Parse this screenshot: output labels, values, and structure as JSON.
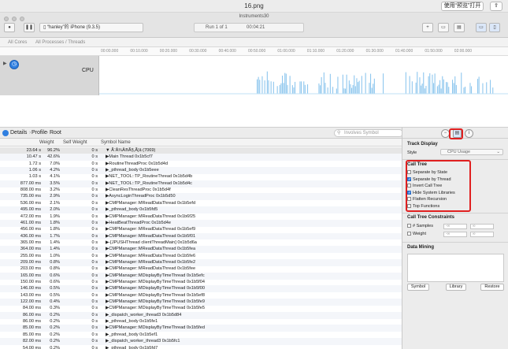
{
  "window": {
    "title": "16.png",
    "open_preview_label": "使用“预览”打开",
    "share_label": "⇪"
  },
  "toolbar": {
    "app_title": "Instruments30",
    "device": "“hanley”的 iPhone (9.3.5)",
    "process": "",
    "run": "Run 1 of 1",
    "time": "00:04:21"
  },
  "scope_bar": {
    "left": "All Cores",
    "right": "All Processes / Threads"
  },
  "ruler_ticks": [
    "00:00.000",
    "00:10.000",
    "00:20.000",
    "00:30.000",
    "00:40.000",
    "00:50.000",
    "01:00.000",
    "01:10.000",
    "01:20.000",
    "01:30.000",
    "01:40.000",
    "01:50.000",
    "02:00.000"
  ],
  "track": {
    "label": "CPU"
  },
  "detail_bar": {
    "details": "Details",
    "profile": "Profile",
    "root": "Root",
    "filter_placeholder": "Involves Symbol"
  },
  "table": {
    "headers": {
      "weight": "Weight",
      "self_weight": "Self Weight",
      "symbol": "Symbol Name"
    },
    "rows": [
      {
        "w": "23.64 s",
        "p": "96.2%",
        "s": "0 s",
        "n": "▼ Ã¨Â¾Â®Ã§,Ã¦â (7069)"
      },
      {
        "w": "10.47 s",
        "p": "42.6%",
        "s": "0 s",
        "n": "▶Main Thread  0x1b5cf7"
      },
      {
        "w": "1.72 s",
        "p": "7.0%",
        "s": "0 s",
        "n": "▶RoutineThreadProc  0x1b5d4d"
      },
      {
        "w": "1.06 s",
        "p": "4.2%",
        "s": "0 s",
        "n": "▶_pthread_body  0x1b5eee"
      },
      {
        "w": "1.03 s",
        "p": "4.1%",
        "s": "0 s",
        "n": "▶NET_TOOL::TP_RoutineThread  0x1b5d4b"
      },
      {
        "w": "877.00 ms",
        "p": "3.5%",
        "s": "0 s",
        "n": "▶NET_TOOL::TP_RoutineThread  0x1b5d4c"
      },
      {
        "w": "808.00 ms",
        "p": "3.2%",
        "s": "0 s",
        "n": "▶CleanResThreadProc  0x1b5d4f"
      },
      {
        "w": "735.00 ms",
        "p": "2.9%",
        "s": "0 s",
        "n": "▶AsyncLoginThreadProc  0x1b5d50"
      },
      {
        "w": "536.00 ms",
        "p": "2.1%",
        "s": "0 s",
        "n": "▶CMPManager::MReadDataThread  0x1b5efd"
      },
      {
        "w": "495.00 ms",
        "p": "2.0%",
        "s": "0 s",
        "n": "▶_pthread_body  0x1b5fd5"
      },
      {
        "w": "472.00 ms",
        "p": "1.9%",
        "s": "0 s",
        "n": "▶CMPManager::MReadDataThread  0x1b6f25"
      },
      {
        "w": "461.00 ms",
        "p": "1.8%",
        "s": "0 s",
        "n": "▶HeatBeatThreadProc  0x1b5d4e"
      },
      {
        "w": "456.00 ms",
        "p": "1.8%",
        "s": "0 s",
        "n": "▶CMPManager::MReadDataThread  0x1b5ef9"
      },
      {
        "w": "436.00 ms",
        "p": "1.7%",
        "s": "0 s",
        "n": "▶CMPManager::MReadDataThread  0x1b5f01"
      },
      {
        "w": "365.00 ms",
        "p": "1.4%",
        "s": "0 s",
        "n": "▶-[JPUSHThread clientThreadMain]  0x1b5d6a"
      },
      {
        "w": "364.00 ms",
        "p": "1.4%",
        "s": "0 s",
        "n": "▶CMPManager::MReadDataThread  0x1b5fea"
      },
      {
        "w": "255.00 ms",
        "p": "1.0%",
        "s": "0 s",
        "n": "▶CMPManager::MReadDataThread  0x1b5fe6"
      },
      {
        "w": "209.00 ms",
        "p": "0.8%",
        "s": "0 s",
        "n": "▶CMPManager::MReadDataThread  0x1b5fe2"
      },
      {
        "w": "203.00 ms",
        "p": "0.8%",
        "s": "0 s",
        "n": "▶CMPManager::MReadDataThread  0x1b5fee"
      },
      {
        "w": "165.00 ms",
        "p": "0.6%",
        "s": "0 s",
        "n": "▶CMPManager::MDisplayByTimeThread  0x1b5efc"
      },
      {
        "w": "150.00 ms",
        "p": "0.6%",
        "s": "0 s",
        "n": "▶CMPManager::MDisplayByTimeThread  0x1b5f04"
      },
      {
        "w": "146.00 ms",
        "p": "0.5%",
        "s": "0 s",
        "n": "▶CMPManager::MDisplayByTimeThread  0x1b5f00"
      },
      {
        "w": "143.00 ms",
        "p": "0.5%",
        "s": "0 s",
        "n": "▶CMPManager::MDisplayByTimeThread  0x1b5ef8"
      },
      {
        "w": "122.00 ms",
        "p": "0.4%",
        "s": "0 s",
        "n": "▶CMPManager::MDisplayByTimeThread  0x1b5fe9"
      },
      {
        "w": "84.00 ms",
        "p": "0.3%",
        "s": "0 s",
        "n": "▶CMPManager::MDisplayByTimeThread  0x1b5fe5"
      },
      {
        "w": "86.00 ms",
        "p": "0.2%",
        "s": "0 s",
        "n": "▶_dispatch_worker_thread3  0x1b5d84"
      },
      {
        "w": "86.00 ms",
        "p": "0.2%",
        "s": "0 s",
        "n": "▶_pthread_body  0x1b5fe1"
      },
      {
        "w": "85.00 ms",
        "p": "0.2%",
        "s": "0 s",
        "n": "▶CMPManager::MDisplayByTimeThread  0x1b5fed"
      },
      {
        "w": "85.00 ms",
        "p": "0.2%",
        "s": "0 s",
        "n": "▶_pthread_body  0x1b5ef1"
      },
      {
        "w": "82.00 ms",
        "p": "0.2%",
        "s": "0 s",
        "n": "▶_dispatch_worker_thread3  0x1b5fc1"
      },
      {
        "w": "54.00 ms",
        "p": "0.2%",
        "s": "0 s",
        "n": "▶_pthread_body  0x1b5fd7"
      },
      {
        "w": "50.00 ms",
        "p": "0.2%",
        "s": "0 s",
        "n": "▶_dispatch_worker_thread3  0x1b5d57"
      }
    ]
  },
  "inspector": {
    "track_display": "Track Display",
    "style_label": "Style",
    "style_value": "CPU Usage",
    "call_tree": "Call Tree",
    "options": [
      {
        "label": "Separate by State",
        "checked": false
      },
      {
        "label": "Separate by Thread",
        "checked": true
      },
      {
        "label": "Invert Call Tree",
        "checked": false
      },
      {
        "label": "Hide System Libraries",
        "checked": true
      },
      {
        "label": "Flatten Recursion",
        "checked": false
      },
      {
        "label": "Top Functions",
        "checked": false
      }
    ],
    "constraints": "Call Tree Constraints",
    "samples_label": "# Samples",
    "weight_label": "Weight",
    "min_ph": "-∞",
    "max_ph": "∞",
    "data_mining": "Data Mining",
    "symbol_btn": "Symbol",
    "library_btn": "Library",
    "restore_btn": "Restore"
  },
  "cpu_activity": [
    0,
    0,
    0,
    0,
    0,
    0,
    0,
    0,
    0,
    0,
    0,
    0,
    0,
    0,
    0,
    0,
    0,
    0,
    0,
    0,
    0,
    0,
    0,
    0,
    0,
    0,
    0,
    0,
    0,
    0,
    0,
    0,
    0,
    0,
    0,
    0,
    0,
    0,
    0,
    0,
    0,
    0,
    0,
    0,
    0,
    0,
    0,
    0,
    0,
    0,
    2,
    0,
    0,
    3,
    0,
    0,
    0,
    0,
    0,
    0,
    0,
    0,
    0,
    0,
    0,
    0,
    0,
    0,
    0,
    0,
    0,
    0,
    0,
    0,
    0,
    0,
    0,
    0,
    0,
    0,
    0,
    0,
    0,
    0,
    0,
    0,
    0,
    0,
    0,
    0,
    0,
    0,
    0,
    0,
    0,
    0,
    0,
    0,
    0,
    0,
    0,
    0,
    0,
    0,
    0,
    0,
    0,
    0,
    0,
    0,
    0,
    0,
    0,
    0,
    0,
    0,
    0,
    0,
    0,
    0,
    0,
    0,
    0,
    0,
    0,
    0,
    0,
    0,
    0,
    0,
    0,
    0,
    0,
    0,
    0,
    0,
    0,
    0,
    0,
    0,
    0,
    0,
    0,
    0,
    0,
    0,
    0,
    0,
    0,
    0,
    0,
    0,
    0,
    0,
    0,
    0,
    0,
    0,
    0,
    0,
    0,
    0,
    0,
    0,
    0,
    0,
    0,
    0,
    0,
    0,
    0,
    0,
    0,
    0,
    0,
    0,
    0,
    0,
    0,
    0,
    0,
    0,
    0,
    0,
    0,
    0,
    0,
    0,
    0,
    0,
    0,
    0,
    0,
    0,
    0,
    0,
    0,
    0,
    0,
    0,
    0,
    0,
    0,
    0,
    0,
    0,
    0,
    0,
    0,
    0,
    0,
    0,
    0,
    0,
    0,
    0,
    0,
    0,
    0,
    0,
    0,
    0,
    0,
    0,
    0,
    0,
    0,
    0,
    0,
    0,
    0,
    0,
    0,
    0,
    0,
    0,
    0,
    0,
    0,
    0,
    0,
    0,
    0,
    0,
    0,
    0,
    0,
    0,
    0,
    0,
    0,
    0,
    0,
    0,
    0,
    0,
    0,
    0,
    0,
    0,
    0,
    0,
    0,
    0,
    0,
    0,
    0,
    0,
    0,
    0,
    0,
    0,
    0,
    0,
    0,
    0,
    0,
    0,
    0,
    0,
    0,
    0,
    0,
    0,
    0,
    0,
    0,
    0,
    0,
    0,
    0,
    0,
    0,
    0,
    0,
    0,
    0,
    0,
    0,
    0,
    0,
    0,
    0,
    0,
    0,
    0,
    0,
    0,
    0,
    0,
    0,
    0,
    0,
    0,
    0,
    0,
    0,
    0,
    0,
    0,
    0,
    0,
    0,
    0,
    0,
    0,
    0,
    0,
    0,
    0,
    0,
    0,
    0,
    0,
    0,
    0,
    0,
    0,
    0,
    0,
    0,
    0,
    0,
    0,
    0,
    0,
    0,
    0,
    0,
    0,
    0,
    0,
    0,
    0,
    0,
    0,
    0,
    0,
    0,
    0,
    0,
    0,
    0,
    0,
    0,
    0,
    0,
    0,
    0,
    0,
    0,
    0,
    0,
    0,
    0,
    0,
    0,
    0,
    0,
    0,
    0,
    0,
    0,
    0,
    0,
    0,
    0,
    0,
    0,
    0,
    0,
    0,
    0,
    0,
    0,
    0,
    0,
    0,
    0,
    0,
    0,
    0,
    0,
    0,
    0,
    0,
    0,
    0,
    0,
    0,
    0,
    0,
    0,
    0,
    0,
    0,
    0,
    0,
    0,
    0,
    0,
    0,
    0,
    0,
    0,
    0,
    0,
    0,
    0,
    0,
    0,
    0,
    0,
    0,
    0,
    0,
    0,
    0,
    0,
    0,
    0,
    0,
    0,
    0,
    0,
    0,
    0,
    0,
    0,
    0,
    0,
    0,
    0,
    0,
    0,
    0,
    0,
    0,
    0,
    0,
    0,
    0,
    0,
    0,
    0,
    0,
    0,
    0,
    0,
    0,
    0,
    0,
    0,
    0,
    0,
    0,
    0,
    0,
    0,
    0,
    0,
    0,
    0,
    0,
    0,
    0,
    0,
    0,
    0,
    0,
    0,
    0,
    0,
    0,
    0,
    0,
    0,
    0,
    0,
    0,
    0,
    0,
    0,
    0,
    0,
    0,
    0,
    0,
    0,
    0,
    0,
    0,
    0,
    0,
    0,
    0,
    0,
    0,
    0,
    0,
    0,
    0,
    0,
    0,
    0,
    0,
    0,
    0,
    0,
    0,
    0,
    0,
    0,
    0,
    0,
    0,
    0,
    0,
    0,
    0,
    0,
    0,
    0,
    0,
    0,
    0,
    0,
    0,
    0,
    0,
    0,
    0,
    0,
    0,
    0,
    0,
    0,
    0,
    0,
    0,
    0,
    0,
    0,
    0,
    0,
    0,
    0,
    0,
    0,
    0,
    0,
    0,
    0,
    0,
    0,
    0,
    0,
    0,
    0,
    0,
    0,
    0,
    0,
    0,
    0,
    0,
    0,
    0,
    0,
    0,
    0,
    0,
    0,
    0,
    0,
    0,
    0,
    0,
    0,
    0,
    0,
    0,
    0,
    0,
    0,
    0,
    0,
    0,
    0,
    0,
    0
  ]
}
